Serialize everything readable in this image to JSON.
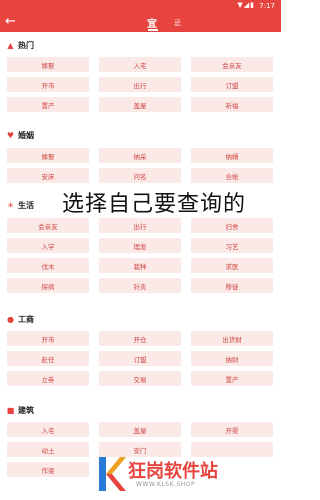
{
  "statusbar": {
    "time": "7:17",
    "icons": "▼◢▮"
  },
  "appbar": {
    "back_icon": "arrow-left-icon",
    "tab_yi": "宜",
    "tab_ji": "忌"
  },
  "sections": [
    {
      "title": "热门",
      "icon": "flame-icon",
      "items": [
        "嫁娶",
        "入宅",
        "会亲友",
        "开市",
        "出行",
        "订盟",
        "置产",
        "盖屋",
        "祈福"
      ]
    },
    {
      "title": "婚姻",
      "icon": "heart-icon",
      "items": [
        "嫁娶",
        "纳采",
        "纳婿",
        "安床",
        "问名",
        "合帐"
      ]
    },
    {
      "title": "生活",
      "icon": "sun-icon",
      "items": [
        "会亲友",
        "出行",
        "扫舍",
        "入学",
        "理发",
        "习艺",
        "伐木",
        "栽种",
        "求医",
        "探病",
        "针灸",
        "移徙"
      ]
    },
    {
      "title": "工商",
      "icon": "person-icon",
      "items": [
        "开市",
        "开仓",
        "出货财",
        "赴任",
        "订盟",
        "纳财",
        "立券",
        "交易",
        "置产"
      ]
    },
    {
      "title": "建筑",
      "icon": "building-icon",
      "items": [
        "入宅",
        "盖屋",
        "开渠",
        "动土",
        "安门",
        "",
        "作梁"
      ]
    }
  ],
  "overlay_text": "选择自己要查询的",
  "watermark": {
    "text": "狂岗软件站",
    "url": "WWW.KLSK.SHOP"
  }
}
